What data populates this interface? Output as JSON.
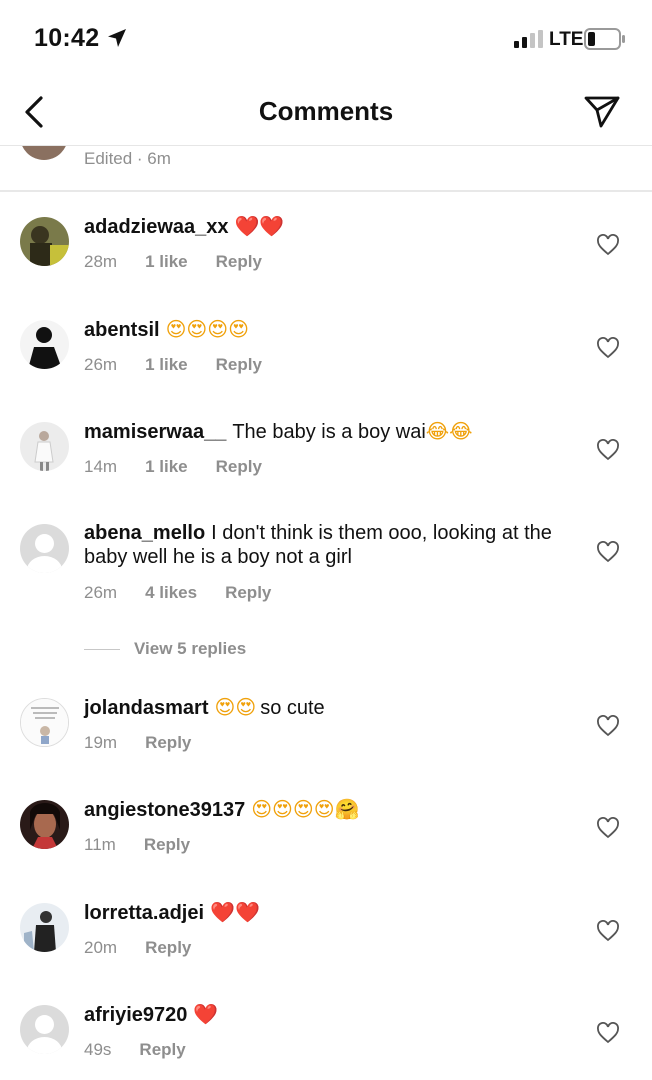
{
  "status_bar": {
    "time": "10:42",
    "network": "LTE"
  },
  "header": {
    "title": "Comments"
  },
  "previous_comment": {
    "meta": "Edited · 6m"
  },
  "comments": [
    {
      "username": "adadziewaa_xx",
      "text": "",
      "emoji": "❤️❤️",
      "time": "28m",
      "likes": "1 like",
      "reply": "Reply"
    },
    {
      "username": "abentsil",
      "text": "",
      "emoji": "😍😍😍😍",
      "time": "26m",
      "likes": "1 like",
      "reply": "Reply"
    },
    {
      "username": "mamiserwaa__",
      "text": "The baby is a boy wai",
      "emoji": "😂😂",
      "time": "14m",
      "likes": "1 like",
      "reply": "Reply"
    },
    {
      "username": "abena_mello",
      "text": "I don't think is them ooo, looking at the baby well he is a boy not a girl",
      "emoji": "",
      "time": "26m",
      "likes": "4 likes",
      "reply": "Reply",
      "view_replies": "View 5 replies"
    },
    {
      "username": "jolandasmart",
      "text": "",
      "emoji": "😍😍",
      "text_after": "so  cute",
      "time": "19m",
      "reply": "Reply"
    },
    {
      "username": "angiestone39137",
      "text": "",
      "emoji": "😍😍😍😍🤗",
      "time": "11m",
      "reply": "Reply"
    },
    {
      "username": "lorretta.adjei",
      "text": "",
      "emoji": "❤️❤️",
      "time": "20m",
      "reply": "Reply"
    },
    {
      "username": "afriyie9720",
      "text": "",
      "emoji": "❤️",
      "time": "49s",
      "reply": "Reply"
    }
  ],
  "colors": {
    "text": "#111111",
    "secondary": "#8e8e8e",
    "heart": "#ed1c24",
    "divider": "#e6e6e6"
  }
}
